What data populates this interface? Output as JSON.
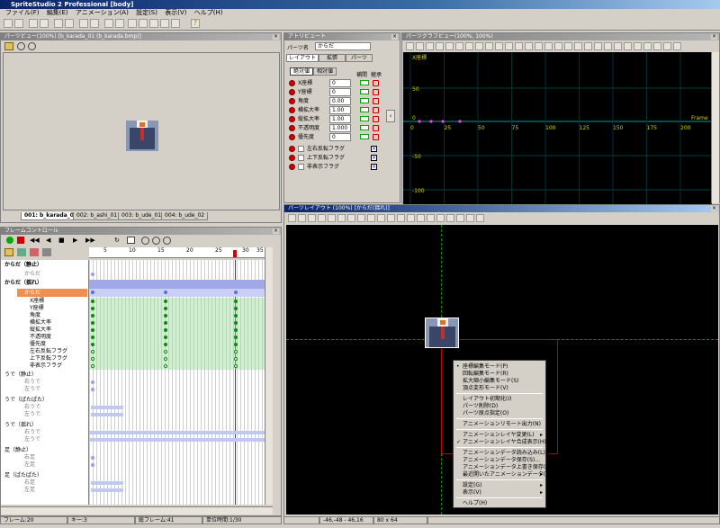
{
  "app": {
    "title": "SpriteStudio 2 Professional [body]"
  },
  "menu": [
    "ファイル(F)",
    "編集(E)",
    "アニメーション(A)",
    "設定(S)",
    "表示(V)",
    "ヘルプ(H)"
  ],
  "part_view": {
    "title": "パーツビュー(100%) [b_karada_01 (b_karada.bmp)]",
    "tabs": [
      "001: b_karada_01",
      "002: b_ashi_01",
      "003: b_ude_01",
      "004: b_ude_02"
    ]
  },
  "frame_control": {
    "title": "フレームコントロール",
    "ruler": [
      "5",
      "10",
      "15",
      "20",
      "25",
      "30",
      "35"
    ],
    "groups": [
      {
        "label": "からだ（静止）",
        "child": "からだ"
      },
      {
        "label": "からだ（揺れ）",
        "child": "からだ",
        "props": [
          "X座標",
          "Y座標",
          "角度",
          "横拡大率",
          "縦拡大率",
          "不透明度",
          "優先度",
          "左右反転フラグ",
          "上下反転フラグ",
          "非表示フラグ"
        ]
      },
      {
        "label": "うで（静止）",
        "children": [
          "右うで",
          "左うで"
        ]
      },
      {
        "label": "うで（ぱたぱた）",
        "children": [
          "右うで",
          "左うで"
        ]
      },
      {
        "label": "うで（揺れ）",
        "children": [
          "右うで",
          "左うで"
        ]
      },
      {
        "label": "足（静止）",
        "children": [
          "右足",
          "左足"
        ]
      },
      {
        "label": "足（ぱたぱた）",
        "children": [
          "右足",
          "左足"
        ]
      }
    ]
  },
  "attr": {
    "part_name_label": "パーツ名",
    "part_name": "からだ",
    "tabs": [
      "レイアウト",
      "拡張",
      "パーツ"
    ],
    "modes": [
      "絶対値",
      "相対値"
    ],
    "headers": [
      "補間",
      "継承"
    ],
    "props": [
      {
        "label": "X座標",
        "value": "0"
      },
      {
        "label": "Y座標",
        "value": "0"
      },
      {
        "label": "角度",
        "value": "0.00"
      },
      {
        "label": "横拡大率",
        "value": "1.00"
      },
      {
        "label": "縦拡大率",
        "value": "1.00"
      },
      {
        "label": "不透明度",
        "value": "1.000"
      },
      {
        "label": "優先度",
        "value": "0"
      }
    ],
    "flags": [
      "左右反転フラグ",
      "上下反転フラグ",
      "非表示フラグ"
    ]
  },
  "graph": {
    "title": "パーツグラフビュー(100%, 100%)",
    "y_label": "X座標",
    "frame_label": "Frame",
    "y_ticks": [
      "50",
      "0",
      "-50",
      "-100"
    ],
    "x_ticks": [
      "0",
      "25",
      "50",
      "75",
      "100",
      "125",
      "150",
      "175",
      "200"
    ]
  },
  "layout": {
    "title": "パーツレイアウト (100%) [からだ(揺れ)]"
  },
  "context_menu": [
    {
      "label": "座標編集モード(P)",
      "mark": "•"
    },
    {
      "label": "回転編集モード(R)"
    },
    {
      "label": "拡大縮小編集モード(S)"
    },
    {
      "label": "頂点変形モード(V)"
    },
    {
      "sep": true
    },
    {
      "label": "レイアウト初期化(I)"
    },
    {
      "label": "パーツ削除(D)"
    },
    {
      "label": "パーツ原点指定(O)"
    },
    {
      "sep": true
    },
    {
      "label": "アニメーションリモート出力(N)"
    },
    {
      "sep": true
    },
    {
      "label": "アニメーションレイヤ変更(L)",
      "arrow": "▸"
    },
    {
      "label": "アニメーションレイヤ合成表示(H)",
      "mark": "✓"
    },
    {
      "sep": true
    },
    {
      "label": "アニメーションデータ読み込み(L)..."
    },
    {
      "label": "アニメーションデータ保存(S)..."
    },
    {
      "label": "アニメーションデータ上書き保存(F)"
    },
    {
      "label": "最近開いたアニメーションデータ(T)",
      "arrow": "▸"
    },
    {
      "sep": true
    },
    {
      "label": "設定(G)",
      "arrow": "▸"
    },
    {
      "label": "表示(V)",
      "arrow": "▸"
    },
    {
      "sep": true
    },
    {
      "label": "ヘルプ(H)"
    }
  ],
  "status": {
    "frame": "フレーム:20",
    "key": "キー:3",
    "total": "総フレーム:41",
    "unit": "単位時間:1/30",
    "coords": "-46,-48 - 46,16",
    "size": "80 x 64"
  }
}
